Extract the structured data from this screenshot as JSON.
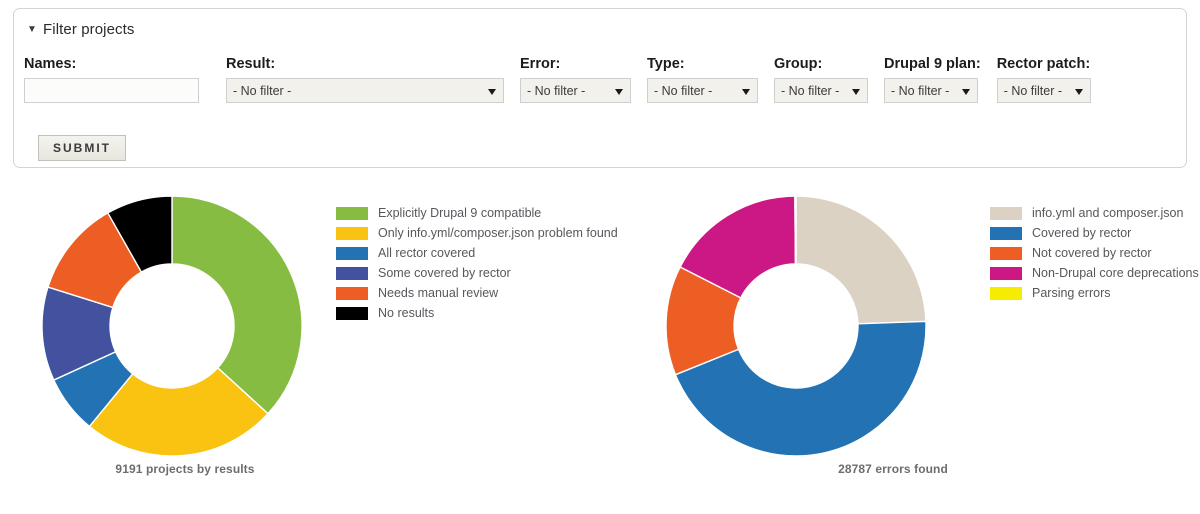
{
  "filter_panel": {
    "legend_title": "Filter projects",
    "disclosure_glyph": "▼",
    "fields": [
      {
        "label": "Names:",
        "kind": "text",
        "value": "",
        "placeholder": ""
      },
      {
        "label": "Result:",
        "kind": "select",
        "value": "- No filter -"
      },
      {
        "label": "Error:",
        "kind": "select",
        "value": "- No filter -"
      },
      {
        "label": "Type:",
        "kind": "select",
        "value": "- No filter -"
      },
      {
        "label": "Group:",
        "kind": "select",
        "value": "- No filter -"
      },
      {
        "label": "Drupal 9 plan:",
        "kind": "select",
        "value": "- No filter -"
      },
      {
        "label": "Rector patch:",
        "kind": "select",
        "value": "- No filter -"
      }
    ],
    "submit_label": "SUBMIT"
  },
  "chart_data": [
    {
      "type": "pie",
      "variant": "donut",
      "title": "9191 projects by results",
      "total": 9191,
      "start_angle": 0,
      "direction": "clockwise",
      "legend_position": "right",
      "categories": [
        "Explicitly Drupal 9 compatible",
        "Only info.yml/composer.json problem found",
        "All rector covered",
        "Some covered by rector",
        "Needs manual review",
        "No results"
      ],
      "values": [
        3381,
        2221,
        664,
        1072,
        1098,
        755
      ],
      "percents": [
        36.8,
        24.2,
        7.2,
        11.7,
        11.9,
        8.2
      ],
      "colors": [
        "#85BC41",
        "#FBC311",
        "#2272B4",
        "#42529E",
        "#EC5E24",
        "#000000"
      ]
    },
    {
      "type": "pie",
      "variant": "donut",
      "title": "28787 errors found",
      "total": 28787,
      "start_angle": 0,
      "direction": "clockwise",
      "legend_position": "right",
      "categories": [
        "info.yml and composer.json",
        "Covered by rector",
        "Not covered by rector",
        "Non-Drupal core deprecations",
        "Parsing errors"
      ],
      "values": [
        7036,
        12795,
        3919,
        4997,
        40
      ],
      "percents": [
        24.4,
        44.5,
        13.6,
        17.4,
        0.14
      ],
      "colors": [
        "#DCD2C3",
        "#2272B4",
        "#EC5E24",
        "#CC1884",
        "#F5EC00"
      ]
    }
  ]
}
